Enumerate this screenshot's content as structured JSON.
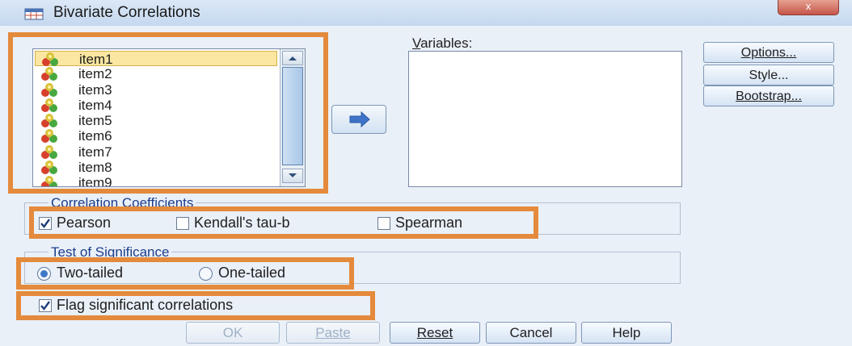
{
  "window": {
    "title": "Bivariate Correlations",
    "close_label": "x"
  },
  "source_list": {
    "items": [
      {
        "label": "item1",
        "selected": true
      },
      {
        "label": "item2",
        "selected": false
      },
      {
        "label": "item3",
        "selected": false
      },
      {
        "label": "item4",
        "selected": false
      },
      {
        "label": "item5",
        "selected": false
      },
      {
        "label": "item6",
        "selected": false
      },
      {
        "label": "item7",
        "selected": false
      },
      {
        "label": "item8",
        "selected": false
      },
      {
        "label": "item9",
        "selected": false
      }
    ],
    "item_icon": "scale-variable-icon"
  },
  "move_button": {
    "icon": "arrow-right-icon"
  },
  "variables": {
    "label": "Variables:"
  },
  "side_buttons": {
    "options": "Options...",
    "style": "Style...",
    "bootstrap": "Bootstrap..."
  },
  "correlation_coefficients": {
    "title": "Correlation Coefficients",
    "pearson": {
      "label": "Pearson",
      "checked": true
    },
    "kendall": {
      "label": "Kendall's tau-b",
      "checked": false
    },
    "spearman": {
      "label": "Spearman",
      "checked": false
    }
  },
  "test_of_significance": {
    "title": "Test of Significance",
    "two_tailed": {
      "label": "Two-tailed",
      "selected": true
    },
    "one_tailed": {
      "label": "One-tailed",
      "selected": false
    }
  },
  "flag": {
    "label": "Flag significant correlations",
    "checked": true
  },
  "bottom_buttons": {
    "ok": "OK",
    "paste": "Paste",
    "reset": "Reset",
    "cancel": "Cancel",
    "help": "Help"
  },
  "colors": {
    "highlight_border": "#e48a3c",
    "selected_item_bg": "#fbe7a1",
    "group_title": "#1c3d8c"
  }
}
